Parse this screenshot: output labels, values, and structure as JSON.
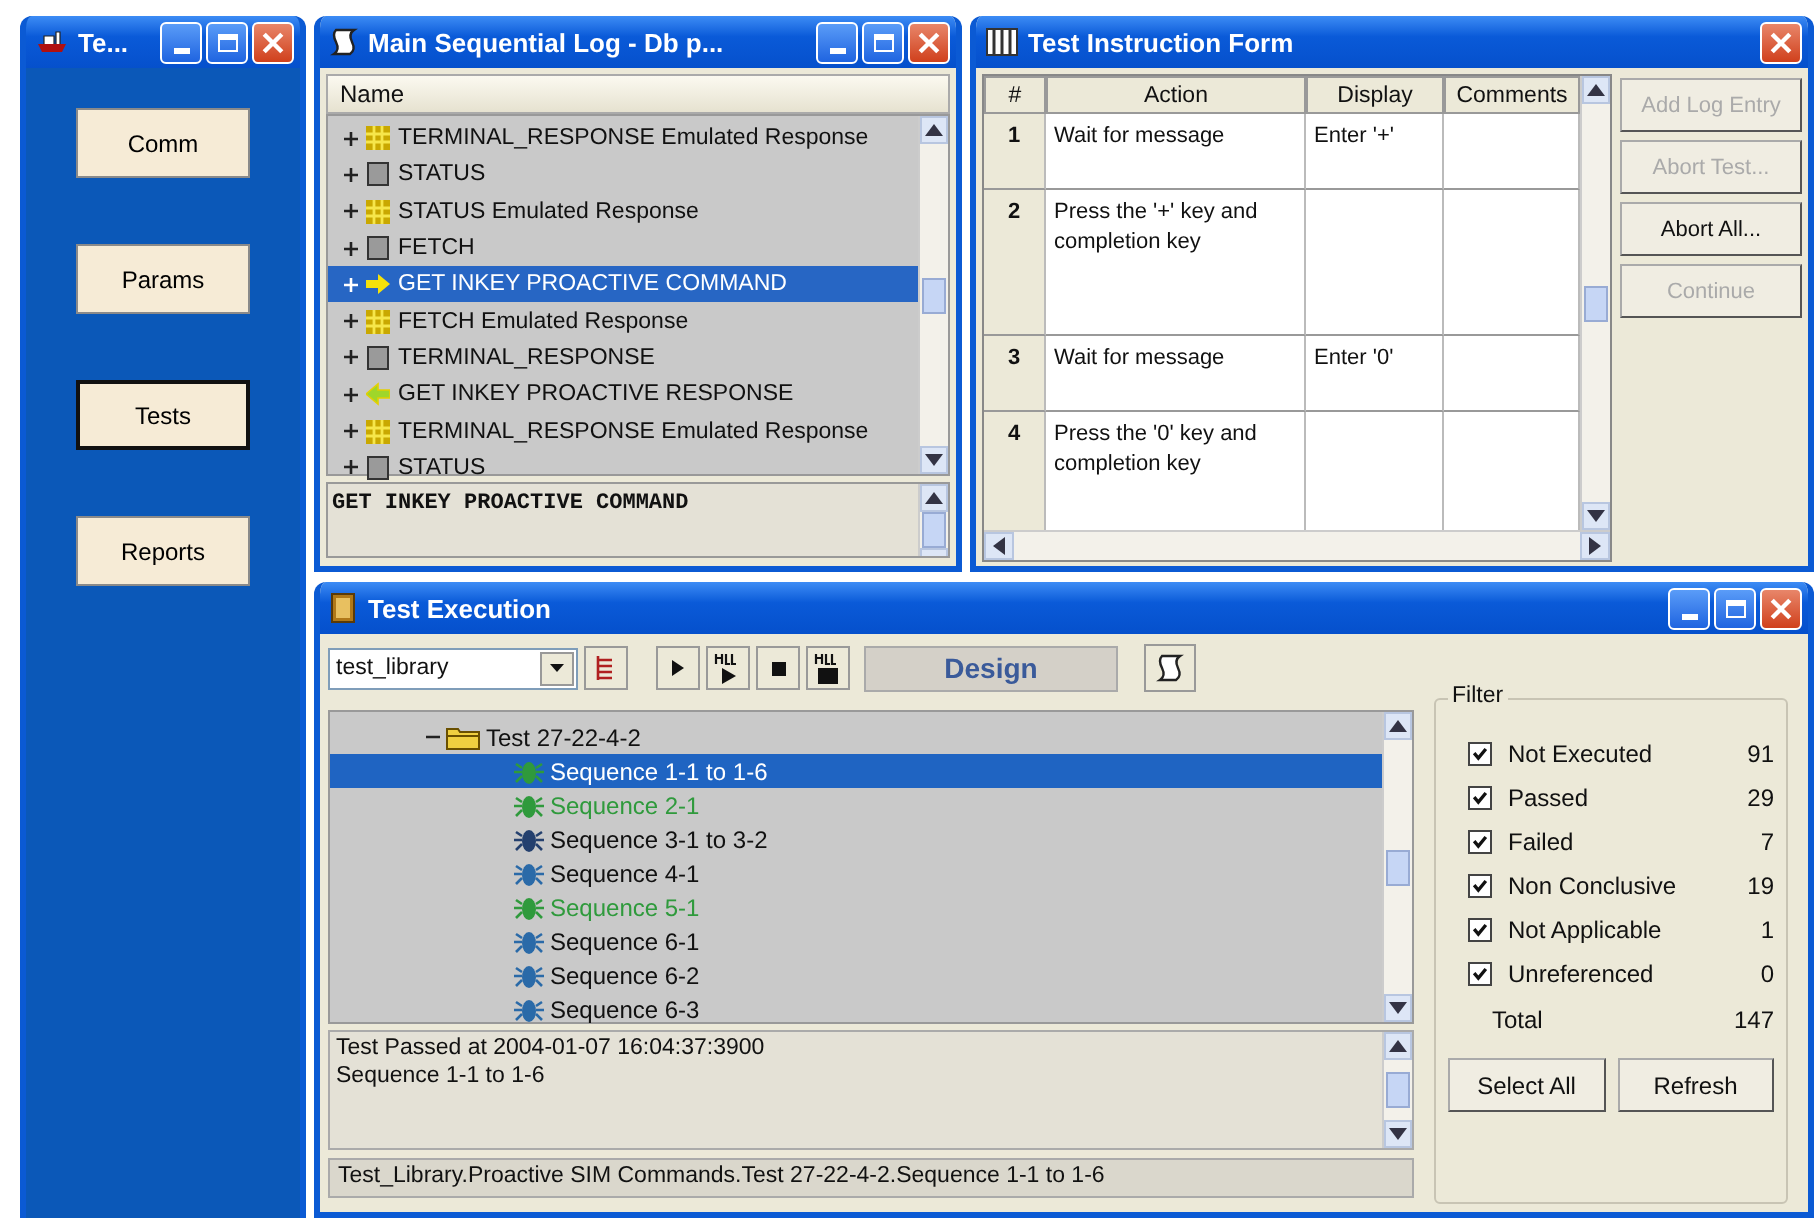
{
  "main_window": {
    "title": "Te...",
    "nav_buttons": [
      {
        "label": "Comm",
        "selected": false
      },
      {
        "label": "Params",
        "selected": false
      },
      {
        "label": "Tests",
        "selected": true
      },
      {
        "label": "Reports",
        "selected": false
      }
    ]
  },
  "log_window": {
    "title": "Main Sequential Log  -  Db p...",
    "column": "Name",
    "items": [
      {
        "label": "TERMINAL_RESPONSE Emulated Response",
        "kind": "emulated",
        "selected": false
      },
      {
        "label": "STATUS",
        "kind": "command",
        "selected": false
      },
      {
        "label": "STATUS Emulated Response",
        "kind": "emulated",
        "selected": false
      },
      {
        "label": "FETCH",
        "kind": "command",
        "selected": false
      },
      {
        "label": "GET INKEY PROACTIVE COMMAND",
        "kind": "proactive",
        "selected": true
      },
      {
        "label": "FETCH Emulated Response",
        "kind": "emulated",
        "selected": false
      },
      {
        "label": "TERMINAL_RESPONSE",
        "kind": "command",
        "selected": false
      },
      {
        "label": "GET INKEY PROACTIVE RESPONSE",
        "kind": "response",
        "selected": false
      },
      {
        "label": "TERMINAL_RESPONSE Emulated Response",
        "kind": "emulated",
        "selected": false
      },
      {
        "label": "STATUS",
        "kind": "command",
        "selected": false
      }
    ],
    "detail": "GET INKEY PROACTIVE COMMAND"
  },
  "instruction_form": {
    "title": "Test Instruction Form",
    "columns": [
      "#",
      "Action",
      "Display",
      "Comments"
    ],
    "rows": [
      {
        "number": "1",
        "action": "Wait for message",
        "display": "Enter '+'"
      },
      {
        "number": "2",
        "action": "Press the '+' key and completion key"
      },
      {
        "number": "3",
        "action": "Wait for message",
        "display": "Enter '0'"
      },
      {
        "number": "4",
        "action": "Press the '0' key and completion key"
      }
    ],
    "buttons": [
      {
        "label": "Add Log Entry",
        "disabled": true
      },
      {
        "label": "Abort Test...",
        "disabled": true
      },
      {
        "label": "Abort All...",
        "disabled": false
      },
      {
        "label": "Continue",
        "disabled": true
      }
    ]
  },
  "execution": {
    "title": "Test Execution",
    "library": "test_library",
    "mode": "Design",
    "tree": {
      "label": "Test 27-22-4-2",
      "expanded": true,
      "children": [
        {
          "label": "Sequence 1-1 to 1-6",
          "color": "#2f9a3c",
          "selected": true
        },
        {
          "label": "Sequence 2-1",
          "passed": true,
          "color": "#2f9a3c",
          "selected": false
        },
        {
          "label": "Sequence 3-1 to 3-2",
          "passed": false,
          "color": "#24406e",
          "selected": false
        },
        {
          "label": "Sequence 4-1",
          "passed": false,
          "color": "#2a6aa8",
          "selected": false
        },
        {
          "label": "Sequence 5-1",
          "passed": true,
          "color": "#2f9a3c",
          "selected": false
        },
        {
          "label": "Sequence 6-1",
          "passed": false,
          "color": "#2a6aa8",
          "selected": false
        },
        {
          "label": "Sequence 6-2",
          "passed": false,
          "color": "#2a6aa8",
          "selected": false
        },
        {
          "label": "Sequence 6-3",
          "passed": false,
          "color": "#2a6aa8",
          "selected": false
        }
      ]
    },
    "output": [
      "Test Passed at 2004-01-07 16:04:37:3900",
      "Sequence 1-1 to 1-6"
    ],
    "path": "Test_Library.Proactive SIM Commands.Test 27-22-4-2.Sequence 1-1 to 1-6",
    "filter": {
      "title": "Filter",
      "items": [
        {
          "label": "Not Executed",
          "count": "91",
          "checked": true
        },
        {
          "label": "Passed",
          "count": "29",
          "checked": true
        },
        {
          "label": "Failed",
          "count": "7",
          "checked": true
        },
        {
          "label": "Non Conclusive",
          "count": "19",
          "checked": true
        },
        {
          "label": "Not Applicable",
          "count": "1",
          "checked": true
        },
        {
          "label": "Unreferenced",
          "count": "0",
          "checked": true
        }
      ],
      "total_label": "Total",
      "total": "147",
      "buttons": [
        "Select All",
        "Refresh"
      ]
    }
  }
}
